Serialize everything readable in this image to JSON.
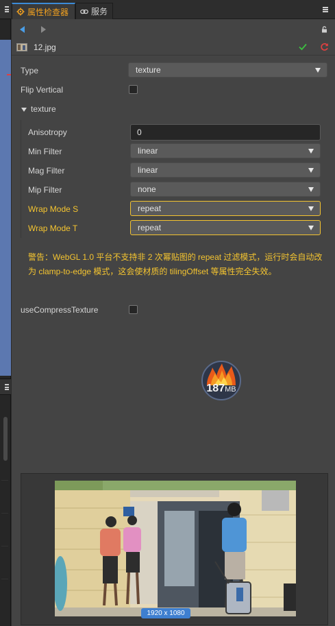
{
  "tabs": {
    "inspector_label": "属性检查器",
    "service_label": "服务"
  },
  "file": {
    "name": "12.jpg"
  },
  "properties": {
    "type_label": "Type",
    "type_value": "texture",
    "flip_vertical_label": "Flip Vertical",
    "flip_vertical_checked": false,
    "section_label": "texture",
    "anisotropy_label": "Anisotropy",
    "anisotropy_value": "0",
    "min_filter_label": "Min Filter",
    "min_filter_value": "linear",
    "mag_filter_label": "Mag Filter",
    "mag_filter_value": "linear",
    "mip_filter_label": "Mip Filter",
    "mip_filter_value": "none",
    "wrap_s_label": "Wrap Mode S",
    "wrap_s_value": "repeat",
    "wrap_t_label": "Wrap Mode T",
    "wrap_t_value": "repeat",
    "use_compress_label": "useCompressTexture",
    "use_compress_checked": false
  },
  "warning": "警告：WebGL 1.0 平台不支持非 2 次幂贴图的 repeat 过滤模式，运行时会自动改为 clamp-to-edge 模式，这会使材质的 tilingOffset 等属性完全失效。",
  "memory": {
    "value": "187",
    "unit": "MB"
  },
  "preview": {
    "size_label": "1920 x 1080"
  },
  "colors": {
    "accent": "#3b8bd8",
    "warning": "#f4c430",
    "apply_green": "#3cc040",
    "revert_red": "#e04040"
  }
}
